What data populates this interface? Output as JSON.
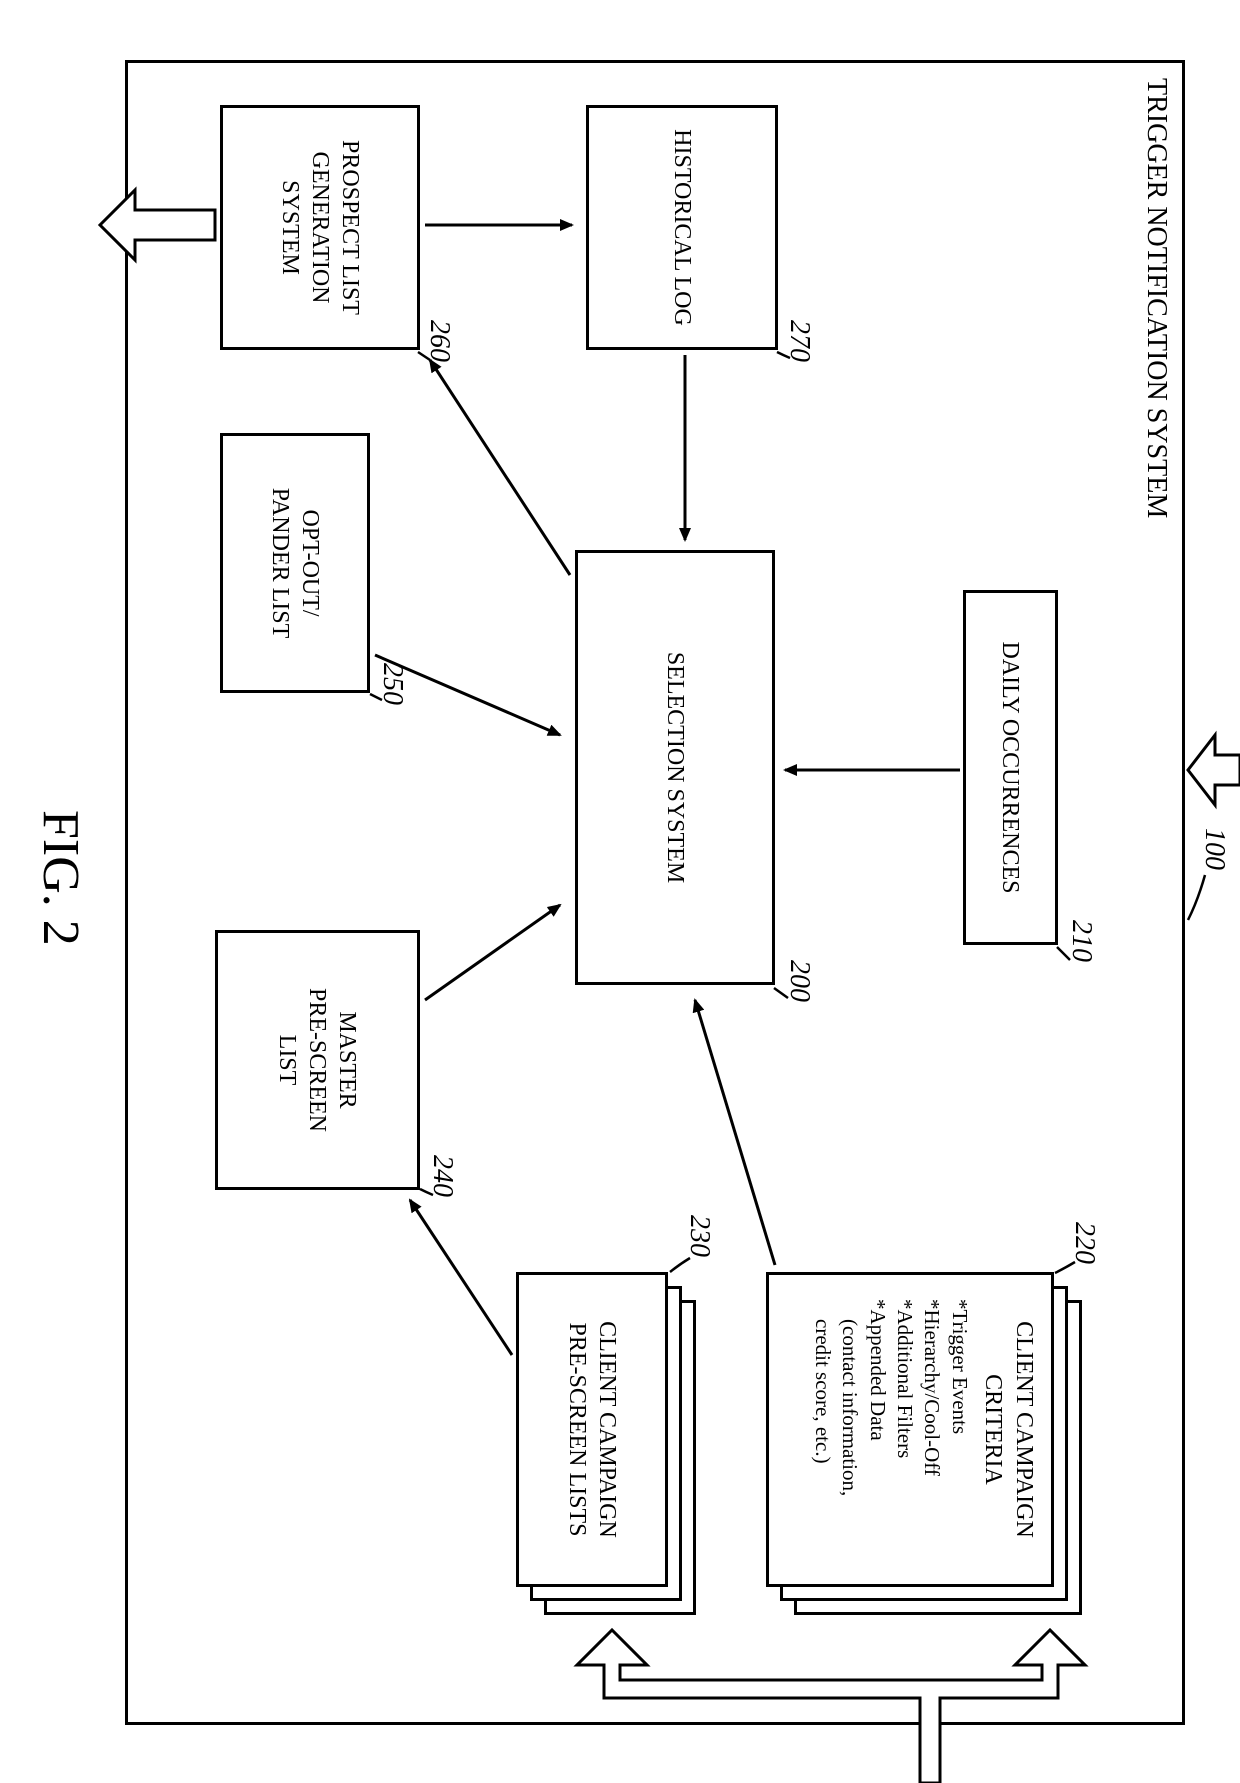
{
  "figure_label": "FIG. 2",
  "system": {
    "title": "TRIGGER NOTIFICATION SYSTEM",
    "ref": "100"
  },
  "boxes": {
    "daily": {
      "label": "DAILY OCCURRENCES",
      "ref": "210"
    },
    "historical": {
      "label": "HISTORICAL LOG",
      "ref": "270"
    },
    "selection": {
      "label": "SELECTION SYSTEM",
      "ref": "200"
    },
    "prospect": {
      "label": "PROSPECT LIST\nGENERATION\nSYSTEM",
      "ref": "260"
    },
    "optout": {
      "label": "OPT-OUT/\nPANDER LIST",
      "ref": "250"
    },
    "master": {
      "label": "MASTER\nPRE-SCREEN\nLIST",
      "ref": "240"
    },
    "criteria": {
      "title": "CLIENT CAMPAIGN\nCRITERIA",
      "items": [
        "*Trigger Events",
        "*Hierarchy/Cool-Off",
        "*Additional Filters",
        "*Appended Data"
      ],
      "sub": "(contact information,\ncredit score, etc.)",
      "ref": "220"
    },
    "prescreen": {
      "label": "CLIENT CAMPAIGN\nPRE-SCREEN LISTS",
      "ref": "230"
    }
  }
}
